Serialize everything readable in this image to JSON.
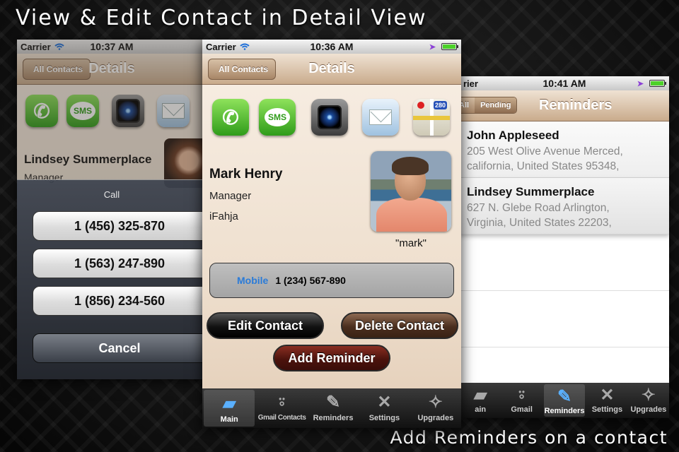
{
  "headline": "View & Edit Contact in Detail View",
  "footline": "Add Reminders on a contact",
  "left_screen": {
    "carrier": "Carrier",
    "time": "10:37 AM",
    "back_label": "All Contacts",
    "title": "Details",
    "contact_name": "Lindsey Summerplace",
    "contact_title": "Manager",
    "action_sheet": {
      "title": "Call",
      "options": [
        "1 (456) 325-870",
        "1 (563) 247-890",
        "1 (856) 234-560"
      ],
      "cancel_label": "Cancel"
    }
  },
  "middle_screen": {
    "carrier": "Carrier",
    "time": "10:36 AM",
    "back_label": "All Contacts",
    "title": "Details",
    "icons": [
      "phone-icon",
      "sms-icon",
      "camera-icon",
      "mail-icon",
      "maps-icon"
    ],
    "sms_label": "SMS",
    "map_shield": "280",
    "contact": {
      "name": "Mark Henry",
      "title": "Manager",
      "company": "iFahja",
      "photo_caption": "\"mark\""
    },
    "phone": {
      "type": "Mobile",
      "number": "1 (234) 567-890"
    },
    "buttons": {
      "edit": "Edit Contact",
      "delete": "Delete Contact",
      "reminder": "Add Reminder"
    },
    "tabs": [
      {
        "label": "Main",
        "icon": "folder-icon",
        "active": true
      },
      {
        "label": "Gmail Contacts",
        "icon": "gmail-icon",
        "active": false
      },
      {
        "label": "Reminders",
        "icon": "notepad-icon",
        "active": false
      },
      {
        "label": "Settings",
        "icon": "tools-icon",
        "active": false
      },
      {
        "label": "Upgrades",
        "icon": "upgrades-icon",
        "active": false
      }
    ]
  },
  "right_screen": {
    "carrier": "rier",
    "time": "10:41 AM",
    "segments": [
      "All",
      "Pending"
    ],
    "title": "Reminders",
    "reminders": [
      {
        "name": "John Appleseed",
        "address_line1": "205 West Olive Avenue Merced,",
        "address_line2": "california, United States 95348,"
      },
      {
        "name": "Lindsey Summerplace",
        "address_line1": "627 N. Glebe Road Arlington,",
        "address_line2": "Virginia, United States 22203,"
      }
    ],
    "tabs": [
      {
        "label": "ain",
        "active": false
      },
      {
        "label": "Gmail",
        "active": false
      },
      {
        "label": "Reminders",
        "active": true
      },
      {
        "label": "Settings",
        "active": false
      },
      {
        "label": "Upgrades",
        "active": false
      }
    ]
  },
  "colors": {
    "accent_blue": "#2a7bd8",
    "nav_tan": "#c9ab8c",
    "delete_brown": "#4a2e1e",
    "reminder_red": "#4c130d"
  }
}
